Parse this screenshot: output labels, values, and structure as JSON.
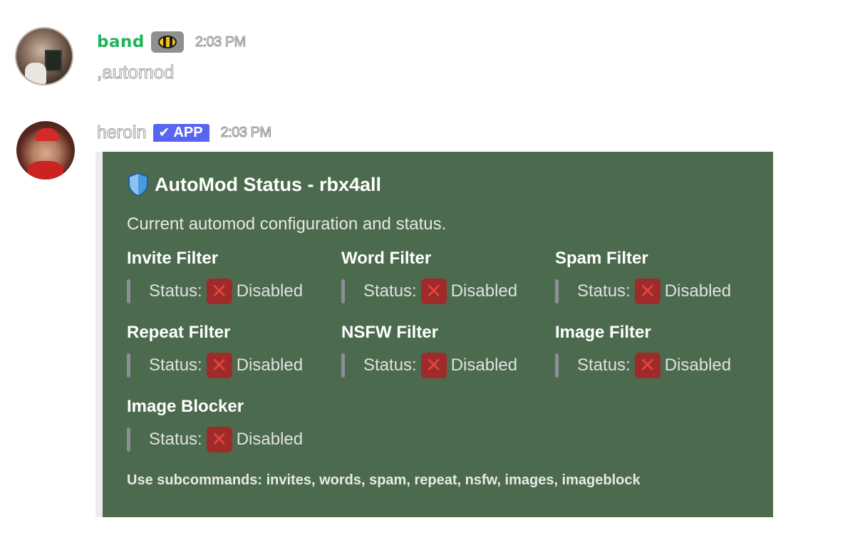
{
  "messages": [
    {
      "author": "band",
      "badge_icon": "bee-icon",
      "timestamp": "2:03 PM",
      "content": ",automod"
    },
    {
      "author": "heroin",
      "app_badge": "APP",
      "timestamp": "2:03 PM"
    }
  ],
  "embed": {
    "accent_color": "#ececec",
    "background_color": "#4c6a4e",
    "title_icon": "shield-icon",
    "title": "AutoMod Status - rbx4all",
    "description": "Current automod configuration and status.",
    "fields": [
      {
        "name": "Invite Filter",
        "status_label": "Status:",
        "status_icon": "cross-mark-icon",
        "status": "Disabled"
      },
      {
        "name": "Word Filter",
        "status_label": "Status:",
        "status_icon": "cross-mark-icon",
        "status": "Disabled"
      },
      {
        "name": "Spam Filter",
        "status_label": "Status:",
        "status_icon": "cross-mark-icon",
        "status": "Disabled"
      },
      {
        "name": "Repeat Filter",
        "status_label": "Status:",
        "status_icon": "cross-mark-icon",
        "status": "Disabled"
      },
      {
        "name": "NSFW Filter",
        "status_label": "Status:",
        "status_icon": "cross-mark-icon",
        "status": "Disabled"
      },
      {
        "name": "Image Filter",
        "status_label": "Status:",
        "status_icon": "cross-mark-icon",
        "status": "Disabled"
      },
      {
        "name": "Image Blocker",
        "status_label": "Status:",
        "status_icon": "cross-mark-icon",
        "status": "Disabled"
      }
    ],
    "footer": "Use subcommands: invites, words, spam, repeat, nsfw, images, imageblock"
  }
}
